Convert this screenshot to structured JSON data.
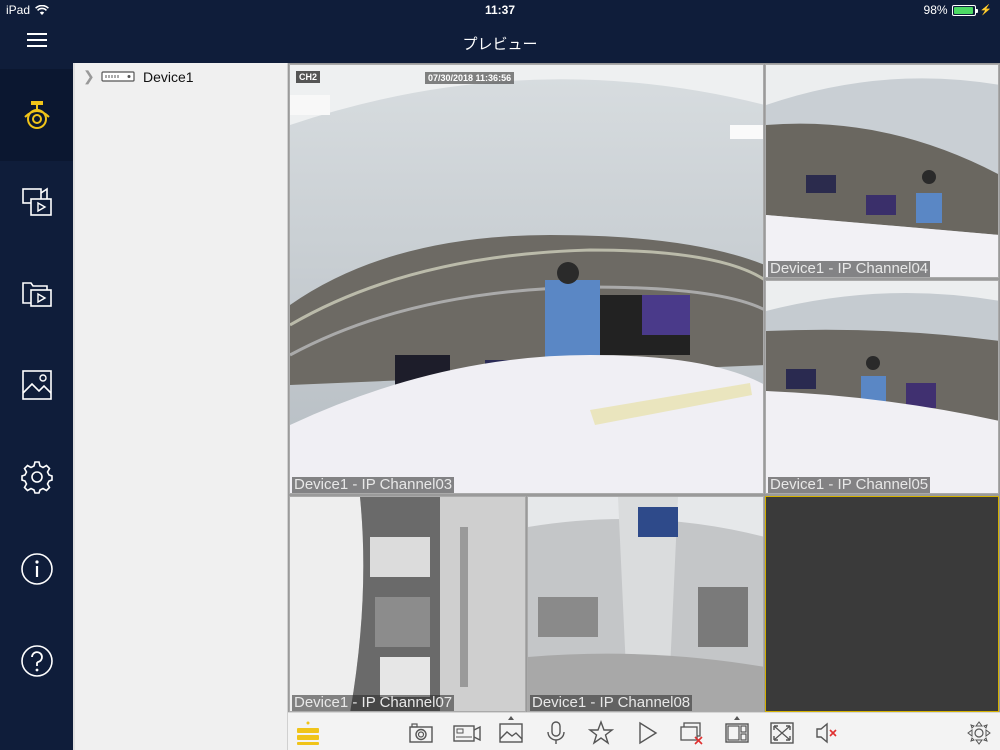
{
  "status_bar": {
    "device": "iPad",
    "time": "11:37",
    "battery": "98%",
    "battery_level": 0.98
  },
  "nav": {
    "title": "プレビュー"
  },
  "sidebar": {
    "items": [
      {
        "icon": "camera-icon",
        "active": true
      },
      {
        "icon": "playback-icon"
      },
      {
        "icon": "files-icon"
      },
      {
        "icon": "pictures-icon"
      },
      {
        "icon": "settings-gear-icon"
      },
      {
        "icon": "info-icon"
      },
      {
        "icon": "help-icon"
      }
    ]
  },
  "device_tree": {
    "items": [
      {
        "label": "Device1"
      }
    ]
  },
  "channels": [
    {
      "label": "Device1 - IP Channel03",
      "osd_name": "CH2",
      "osd_time": "07/30/2018 11:36:56"
    },
    {
      "label": "Device1 - IP Channel04"
    },
    {
      "label": "Device1 - IP Channel05"
    },
    {
      "label": "Device1 - IP Channel07"
    },
    {
      "label": "Device1 - IP Channel08"
    },
    {
      "label": ""
    }
  ],
  "toolbar": {
    "buttons": [
      "stream-icon",
      "snapshot-icon",
      "record-icon",
      "quality-icon",
      "microphone-icon",
      "favorite-icon",
      "play-icon",
      "close-all-icon",
      "layout-icon",
      "fullscreen-icon",
      "audio-mute-icon",
      "ptz-icon"
    ]
  },
  "colors": {
    "nav_bg": "#0f1d3a",
    "accent": "#f0c419",
    "selected_border": "#d4b100"
  }
}
